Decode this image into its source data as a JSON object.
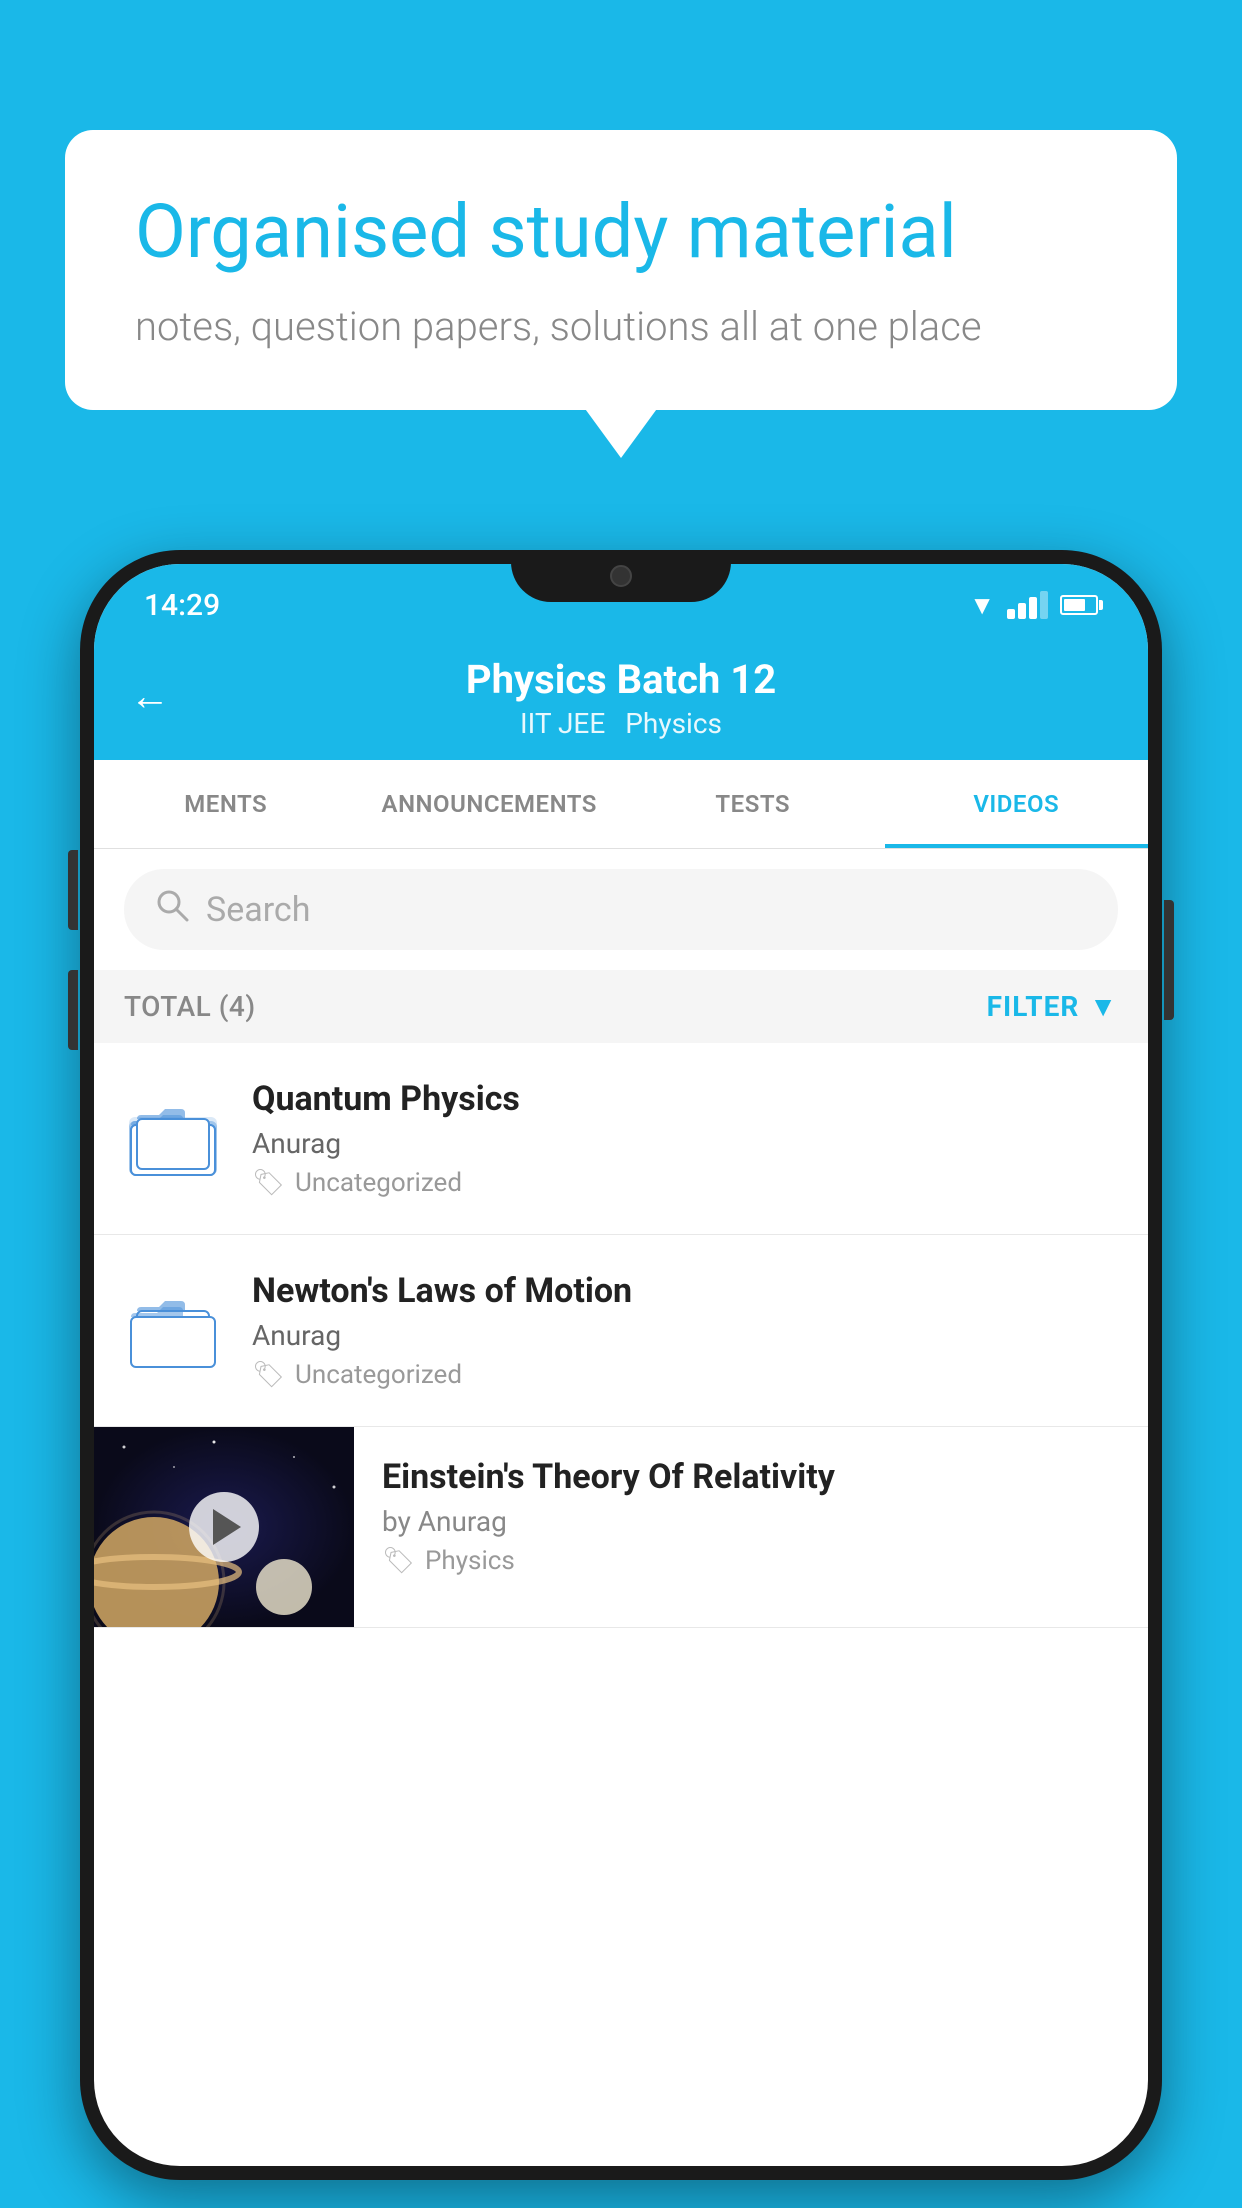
{
  "background": {
    "color": "#1ab8e8"
  },
  "speech_bubble": {
    "title": "Organised study material",
    "subtitle": "notes, question papers, solutions all at one place"
  },
  "status_bar": {
    "time": "14:29"
  },
  "app_header": {
    "title": "Physics Batch 12",
    "tags": [
      "IIT JEE",
      "Physics"
    ],
    "back_label": "←"
  },
  "tabs": [
    {
      "label": "MENTS",
      "active": false
    },
    {
      "label": "ANNOUNCEMENTS",
      "active": false
    },
    {
      "label": "TESTS",
      "active": false
    },
    {
      "label": "VIDEOS",
      "active": true
    }
  ],
  "search": {
    "placeholder": "Search"
  },
  "filter_row": {
    "total": "TOTAL (4)",
    "filter_label": "FILTER"
  },
  "videos": [
    {
      "title": "Quantum Physics",
      "author": "Anurag",
      "tag": "Uncategorized",
      "type": "folder"
    },
    {
      "title": "Newton's Laws of Motion",
      "author": "Anurag",
      "tag": "Uncategorized",
      "type": "folder"
    },
    {
      "title": "Einstein's Theory Of Relativity",
      "author": "by Anurag",
      "tag": "Physics",
      "type": "thumb"
    }
  ]
}
